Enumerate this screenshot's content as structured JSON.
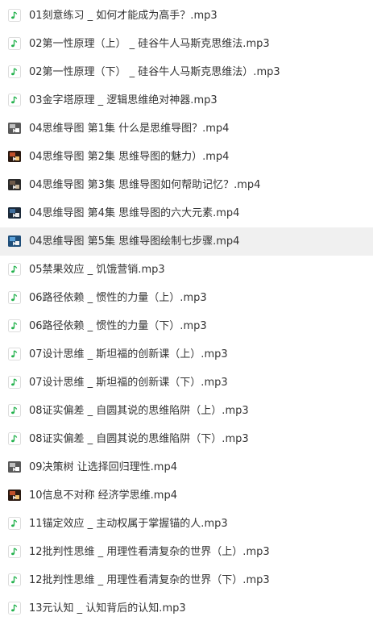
{
  "colors": {
    "audio_note": "#22b14c",
    "text": "#333333",
    "selected_row": "#f0f0f0"
  },
  "files": [
    {
      "name": "01刻意练习 _ 如何才能成为高手？.mp3",
      "icon": "music-note-icon",
      "selected": false
    },
    {
      "name": "02第一性原理（上） _ 硅谷牛人马斯克思维法.mp3",
      "icon": "music-note-icon",
      "selected": false
    },
    {
      "name": "02第一性原理（下） _ 硅谷牛人马斯克思维法）.mp3",
      "icon": "music-note-icon",
      "selected": false
    },
    {
      "name": "03金字塔原理 _ 逻辑思维绝对神器.mp3",
      "icon": "music-note-icon",
      "selected": false
    },
    {
      "name": "04思维导图  第1集 什么是思维导图？.mp4",
      "icon": "video-thumbnail-icon",
      "selected": false
    },
    {
      "name": "04思维导图  第2集 思维导图的魅力）.mp4",
      "icon": "video-thumbnail-icon",
      "selected": false
    },
    {
      "name": "04思维导图  第3集 思维导图如何帮助记忆？.mp4",
      "icon": "video-thumbnail-icon",
      "selected": false
    },
    {
      "name": "04思维导图  第4集 思维导图的六大元素.mp4",
      "icon": "video-thumbnail-icon",
      "selected": false
    },
    {
      "name": "04思维导图  第5集 思维导图绘制七步骤.mp4",
      "icon": "video-thumbnail-icon",
      "selected": true
    },
    {
      "name": "05禁果效应 _ 饥饿营销.mp3",
      "icon": "music-note-icon",
      "selected": false
    },
    {
      "name": "06路径依赖 _ 惯性的力量（上）.mp3",
      "icon": "music-note-icon",
      "selected": false
    },
    {
      "name": "06路径依赖 _ 惯性的力量（下）.mp3",
      "icon": "music-note-icon",
      "selected": false
    },
    {
      "name": "07设计思维 _ 斯坦福的创新课（上）.mp3",
      "icon": "music-note-icon",
      "selected": false
    },
    {
      "name": "07设计思维 _ 斯坦福的创新课（下）.mp3",
      "icon": "music-note-icon",
      "selected": false
    },
    {
      "name": "08证实偏差 _ 自圆其说的思维陷阱（上）.mp3",
      "icon": "music-note-icon",
      "selected": false
    },
    {
      "name": "08证实偏差 _ 自圆其说的思维陷阱（下）.mp3",
      "icon": "music-note-icon",
      "selected": false
    },
    {
      "name": "09决策树  让选择回归理性.mp4",
      "icon": "video-thumbnail-icon",
      "selected": false
    },
    {
      "name": "10信息不对称  经济学思维.mp4",
      "icon": "video-thumbnail-icon",
      "selected": false
    },
    {
      "name": "11锚定效应 _ 主动权属于掌握锚的人.mp3",
      "icon": "music-note-icon",
      "selected": false
    },
    {
      "name": "12批判性思维 _ 用理性看清复杂的世界（上）.mp3",
      "icon": "music-note-icon",
      "selected": false
    },
    {
      "name": "12批判性思维 _ 用理性看清复杂的世界（下）.mp3",
      "icon": "music-note-icon",
      "selected": false
    },
    {
      "name": "13元认知 _ 认知背后的认知.mp3",
      "icon": "music-note-icon",
      "selected": false
    }
  ]
}
